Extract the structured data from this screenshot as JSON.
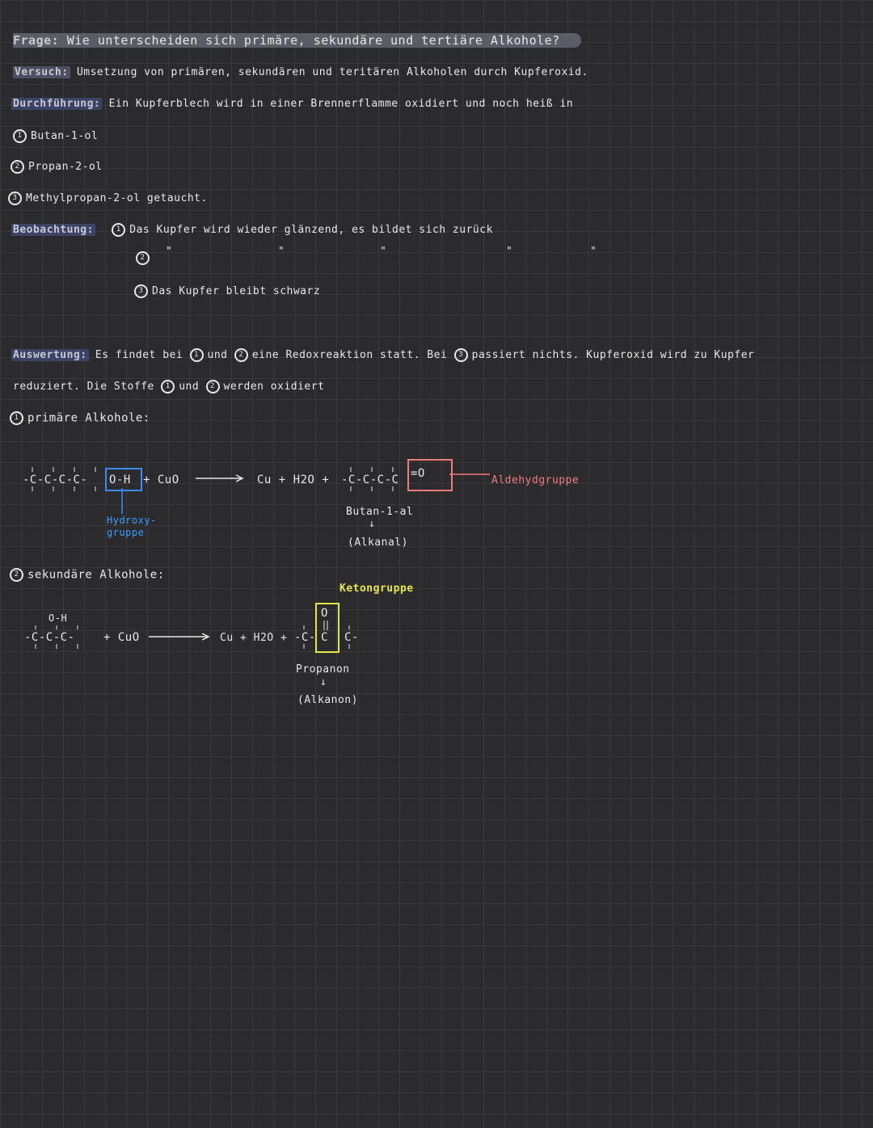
{
  "frage": {
    "label": "Frage:",
    "text": "Wie unterscheiden sich primäre, sekundäre und tertiäre Alkohole?"
  },
  "versuch": {
    "label": "Versuch:",
    "text": "Umsetzung von primären, sekundären und teritären Alkoholen durch Kupferoxid."
  },
  "durchfuehrung": {
    "label": "Durchführung:",
    "text": "Ein Kupferblech wird in einer Brennerflamme oxidiert und noch heiß in",
    "items": [
      {
        "num": "1",
        "text": "Butan-1-ol"
      },
      {
        "num": "2",
        "text": "Propan-2-ol"
      },
      {
        "num": "3",
        "text": "Methylpropan-2-ol getaucht."
      }
    ]
  },
  "beobachtung": {
    "label": "Beobachtung:",
    "line1": {
      "num": "1",
      "text": "Das Kupfer wird wieder glänzend, es bildet sich zurück"
    },
    "ditto": "\"",
    "line2_num": "2",
    "line3": {
      "num": "3",
      "text": "Das Kupfer bleibt schwarz"
    }
  },
  "auswertung": {
    "label": "Auswertung:",
    "line1_a": "Es findet bei",
    "line1_num1": "1",
    "line1_und": "und",
    "line1_num2": "2",
    "line1_b": "eine Redoxreaktion statt. Bei",
    "line1_num3": "3",
    "line1_c": "passiert nichts. Kupferoxid wird zu Kupfer",
    "line2_a": "reduziert. Die Stoffe",
    "line2_num1": "1",
    "line2_und": "und",
    "line2_num2": "2",
    "line2_b": "werden oxidiert"
  },
  "primaer": {
    "num": "1",
    "heading": "primäre Alkohole:",
    "reactant": "-C-C-C-C-",
    "oh": "O-H",
    "plus_cuo": "+ CuO",
    "products": "Cu + H2O +",
    "product_chain": "-C-C-C-C",
    "product_group": "=O",
    "hydroxy_label": "Hydroxy-\ngruppe",
    "aldehyd_label": "Aldehydgruppe",
    "name": "Butan-1-al",
    "arrow": "↓",
    "class": "(Alkanal)"
  },
  "sekundaer": {
    "num": "2",
    "heading": "sekundäre Alkohole:",
    "top_group": "O-H",
    "reactant": "-C-C-C-",
    "plus_cuo": "+ CuO",
    "products": "Cu + H2O +",
    "product_left": "-C-",
    "product_center_top": "O",
    "product_center": "C",
    "product_right": "C-",
    "keton_label": "Ketongruppe",
    "name": "Propanon",
    "arrow": "↓",
    "class": "(Alkanon)"
  }
}
